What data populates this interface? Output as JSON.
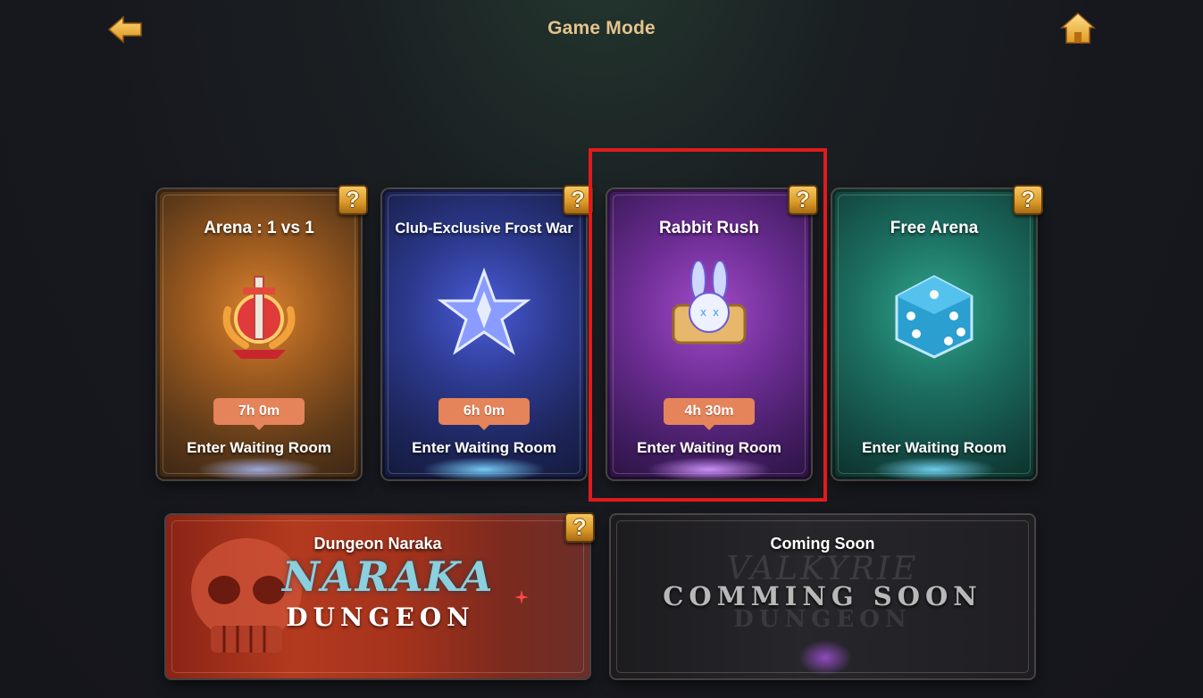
{
  "header": {
    "title": "Game Mode",
    "back_icon": "back-arrow-icon",
    "home_icon": "home-icon"
  },
  "modes": [
    {
      "title": "Arena : 1 vs 1",
      "timer": "7h 0m",
      "action": "Enter Waiting Room",
      "icon": "trophy-sword-laurel-icon",
      "accent": "#d9822f"
    },
    {
      "title": "Club-Exclusive Frost War",
      "timer": "6h 0m",
      "action": "Enter Waiting Room",
      "icon": "ice-crystal-icon",
      "accent": "#4a5bd6"
    },
    {
      "title": "Rabbit Rush",
      "timer": "4h 30m",
      "action": "Enter Waiting Room",
      "icon": "rabbit-scroll-icon",
      "accent": "#a24ac9"
    },
    {
      "title": "Free Arena",
      "action": "Enter Waiting Room",
      "icon": "dice-icon",
      "accent": "#2ea68c"
    }
  ],
  "banners": [
    {
      "title": "Dungeon Naraka",
      "logo_script": "NARAKA",
      "logo_sub": "DUNGEON"
    },
    {
      "title": "Coming Soon",
      "logo_text": "COMMING SOON",
      "ghost_script": "VALKYRIE",
      "ghost_sub": "DUNGEON"
    }
  ],
  "help_icon_label": "?",
  "timer_bg_color": "#e5835a",
  "highlight_color": "#e01b1b"
}
